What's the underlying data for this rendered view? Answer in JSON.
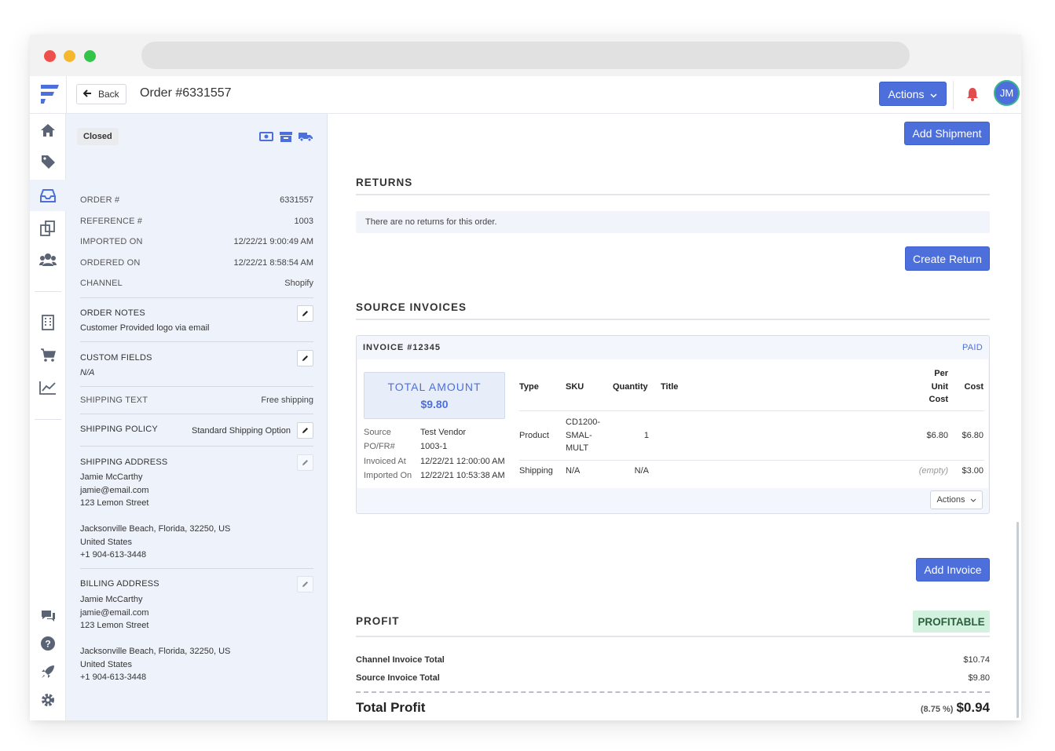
{
  "header": {
    "back_label": "Back",
    "title": "Order #6331557",
    "actions_label": "Actions",
    "avatar_initials": "JM"
  },
  "order_panel": {
    "status": "Closed",
    "fields": [
      {
        "label": "ORDER #",
        "value": "6331557"
      },
      {
        "label": "REFERENCE #",
        "value": "1003"
      },
      {
        "label": "IMPORTED ON",
        "value": "12/22/21 9:00:49 AM"
      },
      {
        "label": "ORDERED ON",
        "value": "12/22/21 8:58:54 AM"
      },
      {
        "label": "CHANNEL",
        "value": "Shopify"
      }
    ],
    "order_notes": {
      "label": "ORDER NOTES",
      "value": "Customer Provided logo via email"
    },
    "custom_fields": {
      "label": "CUSTOM FIELDS",
      "value": "N/A"
    },
    "shipping_text": {
      "label": "SHIPPING TEXT",
      "value": "Free shipping"
    },
    "shipping_policy": {
      "label": "SHIPPING POLICY",
      "value": "Standard Shipping Option"
    },
    "shipping_address": {
      "label": "SHIPPING ADDRESS",
      "name": "Jamie McCarthy",
      "email": "jamie@email.com",
      "street": "123 Lemon Street",
      "city_line": "Jacksonville Beach, Florida, 32250, US",
      "country": "United States",
      "phone": "+1 904-613-3448"
    },
    "billing_address": {
      "label": "BILLING ADDRESS",
      "name": "Jamie McCarthy",
      "email": "jamie@email.com",
      "street": "123 Lemon Street",
      "city_line": "Jacksonville Beach, Florida, 32250, US",
      "country": "United States",
      "phone": "+1 904-613-3448"
    }
  },
  "main": {
    "add_shipment_label": "Add Shipment",
    "returns": {
      "title": "RETURNS",
      "empty_text": "There are no returns for this order.",
      "create_label": "Create Return"
    },
    "source_invoices": {
      "title": "SOURCE INVOICES",
      "invoice": {
        "number": "INVOICE #12345",
        "status": "PAID",
        "total_label": "TOTAL AMOUNT",
        "total_value": "$9.80",
        "meta": [
          {
            "k": "Source",
            "v": "Test Vendor"
          },
          {
            "k": "PO/FR#",
            "v": "1003-1"
          },
          {
            "k": "Invoiced At",
            "v": "12/22/21 12:00:00 AM"
          },
          {
            "k": "Imported On",
            "v": "12/22/21 10:53:38 AM"
          }
        ],
        "columns": [
          "Type",
          "SKU",
          "Quantity",
          "Title",
          "Per",
          "Unit",
          "Cost",
          "Cost"
        ],
        "rows": [
          {
            "type": "Product",
            "sku_1": "CD1200-",
            "sku_2": "SMAL-",
            "sku_3": "MULT",
            "quantity": "1",
            "title": "",
            "unit_cost": "$6.80",
            "cost": "$6.80"
          },
          {
            "type": "Shipping",
            "sku": "N/A",
            "quantity": "N/A",
            "title": "",
            "unit_cost": "(empty)",
            "cost": "$3.00"
          }
        ],
        "actions_label": "Actions"
      },
      "add_invoice_label": "Add Invoice"
    },
    "profit": {
      "title": "PROFIT",
      "badge": "PROFITABLE",
      "channel_label": "Channel Invoice Total",
      "channel_value": "$10.74",
      "source_label": "Source Invoice Total",
      "source_value": "$9.80",
      "total_label": "Total Profit",
      "total_pct": "(8.75 %)",
      "total_value": "$0.94"
    }
  },
  "colors": {
    "accent": "#4d6fdc",
    "panel_bg": "#eef3fb",
    "profitable_bg": "#d2f2df",
    "bell": "#e24c4c"
  },
  "icons": [
    "logo-icon",
    "home-icon",
    "tag-icon",
    "inbox-icon",
    "copy-icon",
    "users-icon",
    "building-icon",
    "cart-icon",
    "chart-icon",
    "chat-icon",
    "help-icon",
    "rocket-icon",
    "gear-icon",
    "bell-icon",
    "money-icon",
    "archive-icon",
    "truck-icon",
    "pencil-icon",
    "arrow-left-icon",
    "chevron-down-icon"
  ]
}
